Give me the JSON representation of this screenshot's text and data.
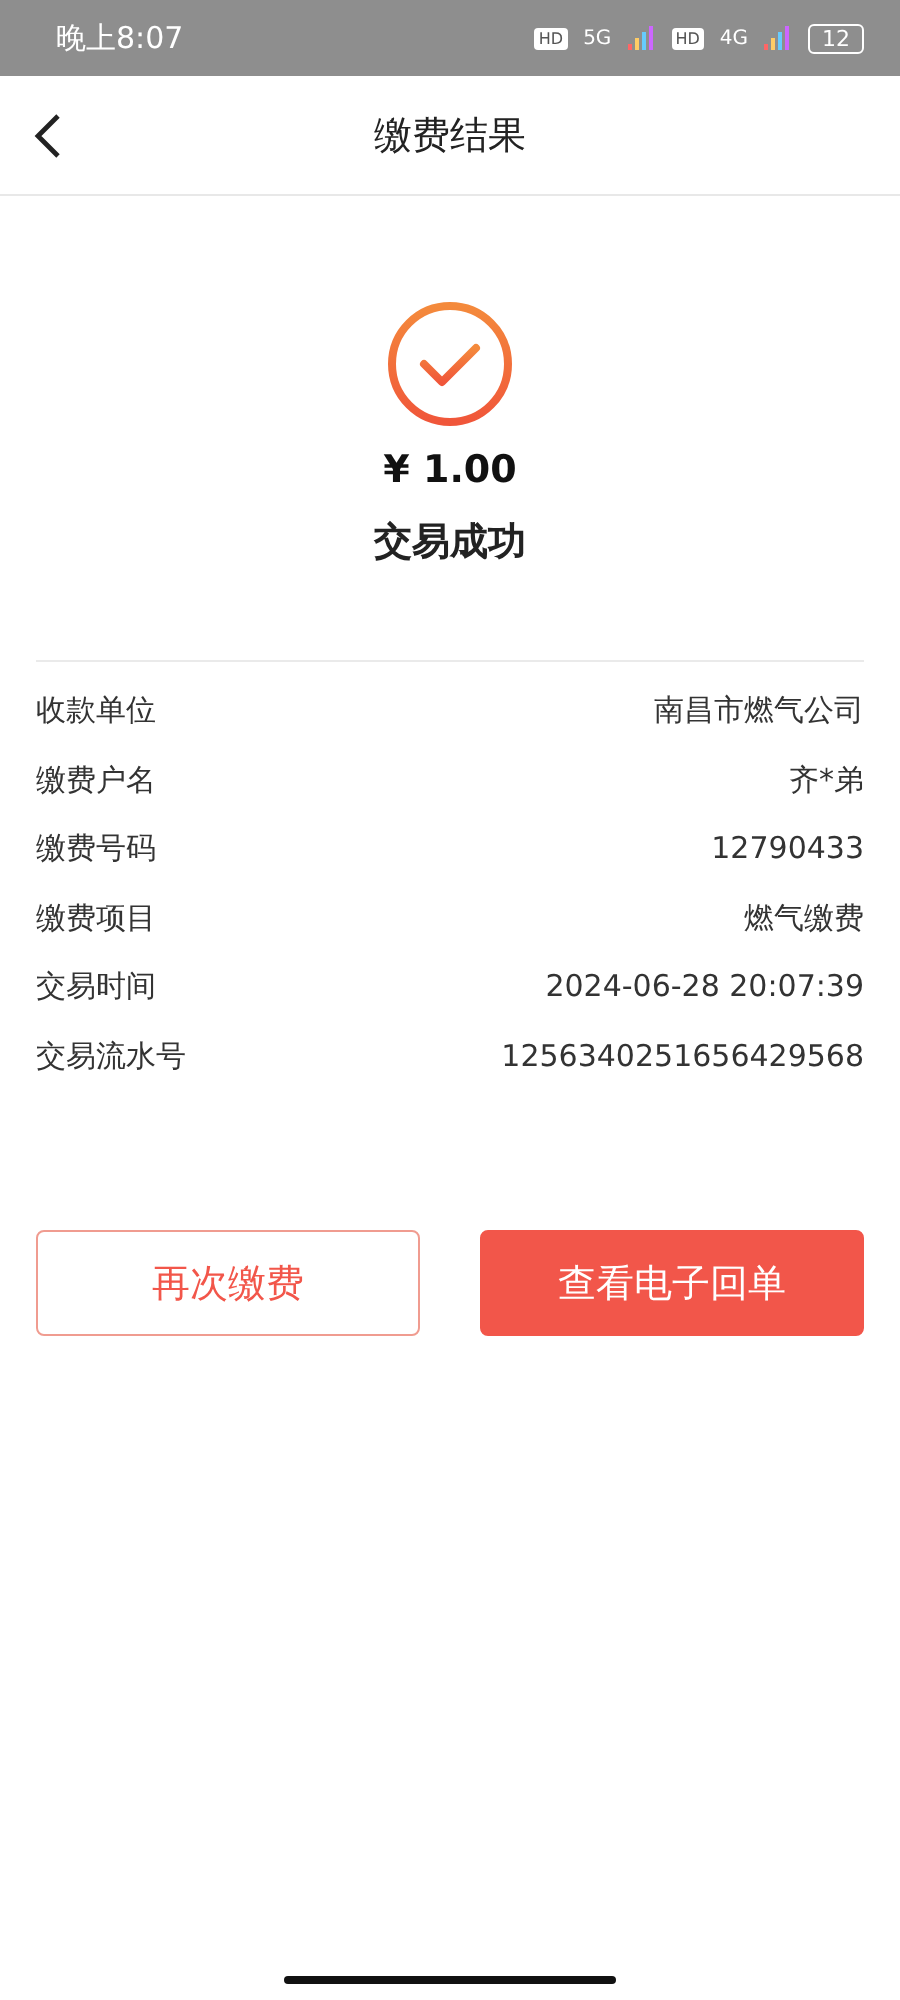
{
  "status_bar": {
    "time": "晚上8:07",
    "sims": [
      {
        "hd": "HD",
        "network": "5G"
      },
      {
        "hd": "HD",
        "network": "4G"
      }
    ],
    "battery": "12"
  },
  "header": {
    "title": "缴费结果"
  },
  "result": {
    "amount": "¥ 1.00",
    "status": "交易成功"
  },
  "details": [
    {
      "label": "收款单位",
      "value": "南昌市燃气公司"
    },
    {
      "label": "缴费户名",
      "value": "齐*弟"
    },
    {
      "label": "缴费号码",
      "value": "12790433"
    },
    {
      "label": "缴费项目",
      "value": "燃气缴费"
    },
    {
      "label": "交易时间",
      "value": "2024-06-28 20:07:39"
    },
    {
      "label": "交易流水号",
      "value": "1256340251656429568"
    }
  ],
  "buttons": [
    {
      "label": "再次缴费",
      "kind": "outline"
    },
    {
      "label": "查看电子回单",
      "kind": "filled"
    }
  ]
}
